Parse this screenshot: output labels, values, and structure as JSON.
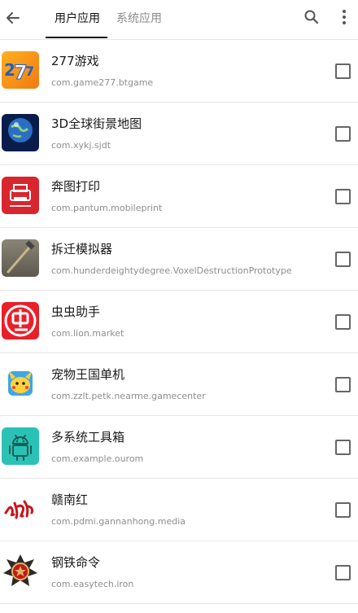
{
  "header": {
    "back_icon": "arrow-left-icon",
    "tabs": [
      {
        "label": "用户应用",
        "active": true
      },
      {
        "label": "系统应用",
        "active": false
      }
    ],
    "search_icon": "search-icon",
    "more_icon": "more-vertical-icon"
  },
  "apps": [
    {
      "name": "277游戏",
      "package": "com.game277.btgame",
      "checked": false,
      "icon": "game277-icon",
      "icon_color": "#f39c12"
    },
    {
      "name": "3D全球街景地图",
      "package": "com.xykj.sjdt",
      "checked": false,
      "icon": "globe-icon",
      "icon_color": "#0a1d4a"
    },
    {
      "name": "奔图打印",
      "package": "com.pantum.mobileprint",
      "checked": false,
      "icon": "printer-icon",
      "icon_color": "#d7262e"
    },
    {
      "name": "拆迁模拟器",
      "package": "com.hunderdeightydegree.VoxelDestructionPrototype",
      "checked": false,
      "icon": "hammer-icon",
      "icon_color": "#6e6a5e"
    },
    {
      "name": "虫虫助手",
      "package": "com.lion.market",
      "checked": false,
      "icon": "bug-icon",
      "icon_color": "#e8202a"
    },
    {
      "name": "宠物王国单机",
      "package": "com.zzlt.petk.nearme.gamecenter",
      "checked": false,
      "icon": "pet-icon",
      "icon_color": "#ffd23d"
    },
    {
      "name": "多系统工具箱",
      "package": "com.example.ourom",
      "checked": false,
      "icon": "android-icon",
      "icon_color": "#2bc2b6"
    },
    {
      "name": "赣南红",
      "package": "com.pdmi.gannanhong.media",
      "checked": false,
      "icon": "calligraphy-icon",
      "icon_color": "#c8141c"
    },
    {
      "name": "钢铁命令",
      "package": "com.easytech.iron",
      "checked": false,
      "icon": "emblem-icon",
      "icon_color": "#8a6d3b"
    }
  ]
}
